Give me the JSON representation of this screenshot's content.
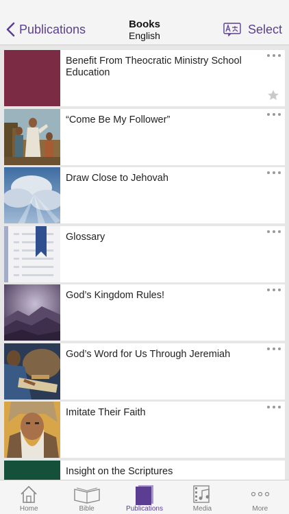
{
  "nav": {
    "back_label": "Publications",
    "title": "Books",
    "subtitle": "English",
    "select_label": "Select"
  },
  "items": [
    {
      "title": "Benefit From Theocratic Ministry School Education",
      "thumb": "solid-maroon",
      "favorite": true
    },
    {
      "title": "“Come Be My Follower”",
      "thumb": "painting-jesus-crowd",
      "favorite": false
    },
    {
      "title": "Draw Close to Jehovah",
      "thumb": "sky-clouds-sunrays",
      "favorite": false
    },
    {
      "title": "Glossary",
      "thumb": "document-bookmark",
      "favorite": false
    },
    {
      "title": "God’s Kingdom Rules!",
      "thumb": "purple-mountains",
      "favorite": false
    },
    {
      "title": "God’s Word for Us Through Jeremiah",
      "thumb": "painting-scribe-scroll",
      "favorite": false
    },
    {
      "title": "Imitate Their Faith",
      "thumb": "painting-bearded-man",
      "favorite": false
    },
    {
      "title": "Insight on the Scriptures",
      "thumb": "solid-green",
      "favorite": false
    }
  ],
  "tabs": [
    {
      "label": "Home",
      "icon": "house-icon",
      "active": false
    },
    {
      "label": "Bible",
      "icon": "open-book-icon",
      "active": false
    },
    {
      "label": "Publications",
      "icon": "publications-icon",
      "active": true
    },
    {
      "label": "Media",
      "icon": "film-music-icon",
      "active": false
    },
    {
      "label": "More",
      "icon": "ellipsis-icon",
      "active": false
    }
  ],
  "colors": {
    "accent": "#5b3e91",
    "maroon": "#7c2b45",
    "green": "#14503a"
  }
}
